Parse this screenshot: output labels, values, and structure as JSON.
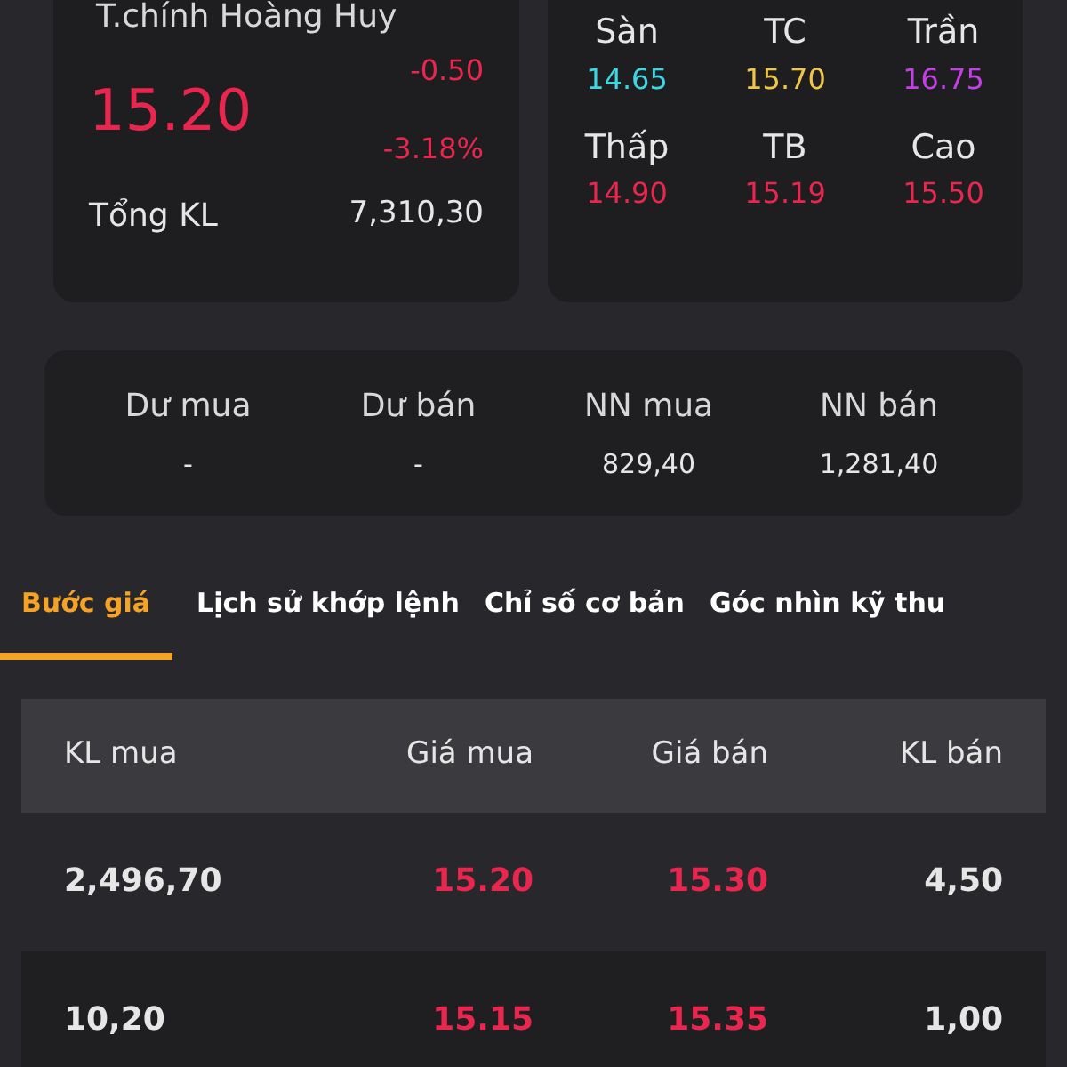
{
  "stock": {
    "name": "T.chính Hoàng Huy",
    "price": "15.20",
    "change": "-0.50",
    "change_pct": "-3.18%",
    "color": "#e8264e",
    "volume_label": "Tổng KL",
    "volume": "7,310,30"
  },
  "price_stats": [
    {
      "label": "Sàn",
      "value": "14.65",
      "color": "#3dd6e3"
    },
    {
      "label": "TC",
      "value": "15.70",
      "color": "#f0c64a"
    },
    {
      "label": "Trần",
      "value": "16.75",
      "color": "#c43fe6"
    },
    {
      "label": "Thấp",
      "value": "14.90",
      "color": "#e8264e"
    },
    {
      "label": "TB",
      "value": "15.19",
      "color": "#e8264e"
    },
    {
      "label": "Cao",
      "value": "15.50",
      "color": "#e8264e"
    }
  ],
  "trade_stats": [
    {
      "label": "Dư mua",
      "value": "-"
    },
    {
      "label": "Dư bán",
      "value": "-"
    },
    {
      "label": "NN mua",
      "value": "829,40"
    },
    {
      "label": "NN bán",
      "value": "1,281,40"
    }
  ],
  "tabs": [
    {
      "label": "Bước giá",
      "selected": true
    },
    {
      "label": "Lịch sử khớp lệnh",
      "selected": false
    },
    {
      "label": "Chỉ số cơ bản",
      "selected": false
    },
    {
      "label": "Góc nhìn kỹ thu",
      "selected": false
    }
  ],
  "order_book": {
    "columns": [
      "KL mua",
      "Giá mua",
      "Giá bán",
      "KL bán"
    ],
    "rows": [
      {
        "bid_volume": "2,496,70",
        "bid_price": "15.20",
        "ask_price": "15.30",
        "color": "#e8264e",
        "ask_volume": "4,50"
      },
      {
        "bid_volume": "10,20",
        "bid_price": "15.15",
        "ask_price": "15.35",
        "color": "#e8264e",
        "ask_volume": "1,00"
      }
    ]
  }
}
